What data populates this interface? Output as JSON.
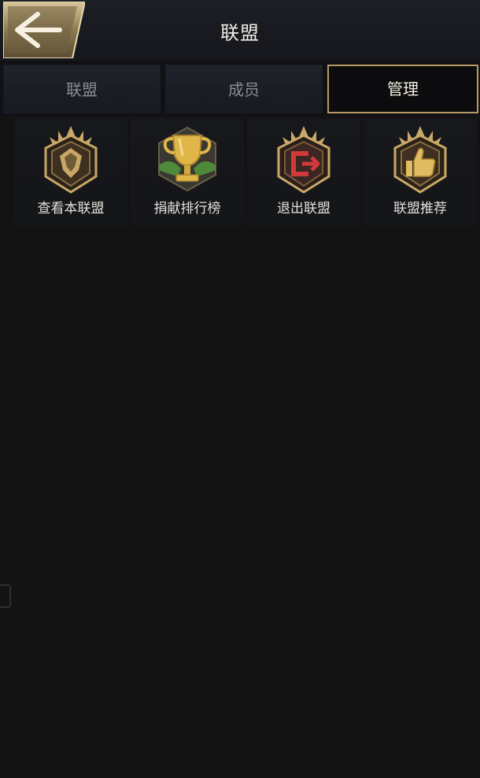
{
  "header": {
    "title": "联盟",
    "back_icon": "arrow-left-icon"
  },
  "tabs": [
    {
      "label": "联盟",
      "active": false
    },
    {
      "label": "成员",
      "active": false
    },
    {
      "label": "管理",
      "active": true
    }
  ],
  "actions": [
    {
      "label": "查看本联盟",
      "icon": "alliance-crest-icon"
    },
    {
      "label": "捐献排行榜",
      "icon": "trophy-icon"
    },
    {
      "label": "退出联盟",
      "icon": "exit-door-icon"
    },
    {
      "label": "联盟推荐",
      "icon": "thumbs-up-icon"
    }
  ],
  "colors": {
    "gold": "#c9a766",
    "background": "#131313",
    "active_tab_border": "#b79a64",
    "exit_red": "#d23a3a"
  }
}
